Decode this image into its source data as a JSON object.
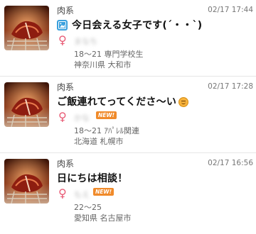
{
  "items": [
    {
      "category": "肉系",
      "time": "02/17 17:44",
      "title": "今日会える女子です(´・・`)",
      "has_title_icon": true,
      "has_emoji": false,
      "gender_symbol": "♀",
      "name": "まなち",
      "is_new": false,
      "new_label": "",
      "age_occupation": "18～21 専門学校生",
      "location": "神奈川県 大和市"
    },
    {
      "category": "肉系",
      "time": "02/17 17:28",
      "title": "ご飯連れてってくださ〜い",
      "has_title_icon": false,
      "has_emoji": true,
      "gender_symbol": "♀",
      "name": "かな",
      "is_new": true,
      "new_label": "NEW!",
      "age_occupation": "18～21 ｱﾊﾟﾚﾙ関連",
      "location": "北海道 札幌市"
    },
    {
      "category": "肉系",
      "time": "02/17 16:56",
      "title": "日にちは相談！",
      "has_title_icon": false,
      "has_emoji": false,
      "gender_symbol": "♀",
      "name": "もえ",
      "is_new": true,
      "new_label": "NEW!",
      "age_occupation": "22～25",
      "location": "愛知県 名古屋市"
    }
  ]
}
